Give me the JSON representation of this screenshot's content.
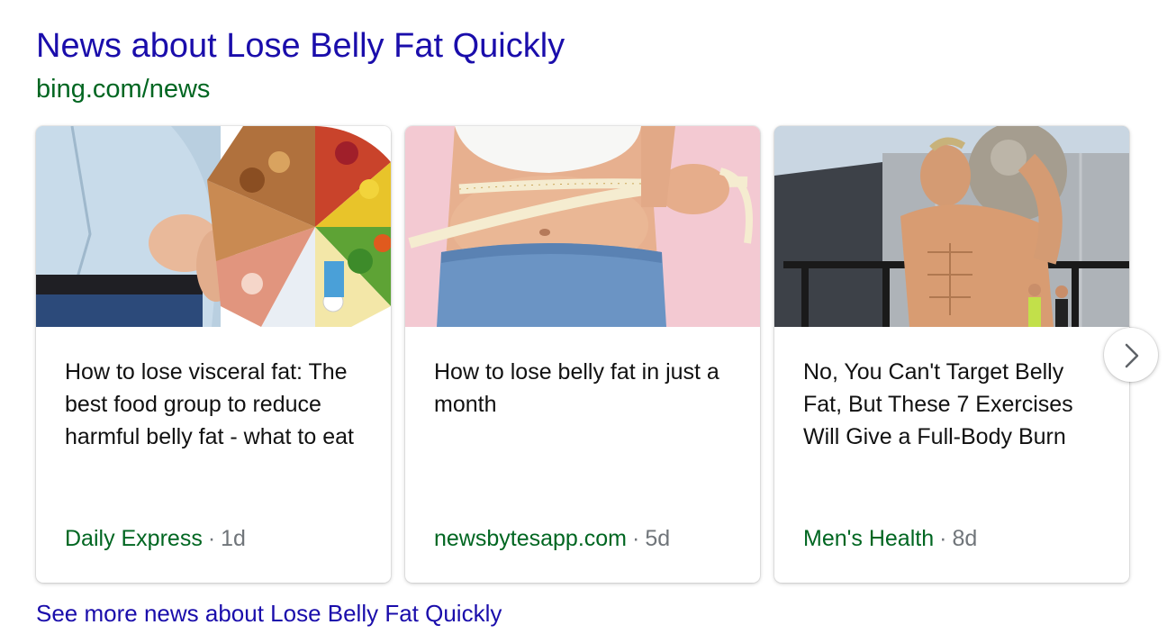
{
  "header": {
    "title": "News about Lose Belly Fat Quickly",
    "source": "bing.com/news"
  },
  "cards": [
    {
      "title": "How to lose visceral fat: The best food group to reduce harmful belly fat - what to eat",
      "publisher": "Daily Express",
      "separator": "·",
      "age": "1d",
      "image": "belly-and-food-groups-photo"
    },
    {
      "title": "How to lose belly fat in just a month",
      "publisher": "newsbytesapp.com",
      "separator": "·",
      "age": "5d",
      "image": "measuring-tape-waist-photo"
    },
    {
      "title": "No, You Can't Target Belly Fat, But These 7 Exercises Will Give a Full-Body Burn",
      "publisher": "Men's Health",
      "separator": "·",
      "age": "8d",
      "image": "man-lifting-stone-photo"
    }
  ],
  "carousel": {
    "next_icon": "chevron-right-icon"
  },
  "footer": {
    "see_more": "See more news about Lose Belly Fat Quickly"
  },
  "colors": {
    "link": "#1a0dab",
    "source_green": "#006621",
    "muted": "#70757a"
  }
}
